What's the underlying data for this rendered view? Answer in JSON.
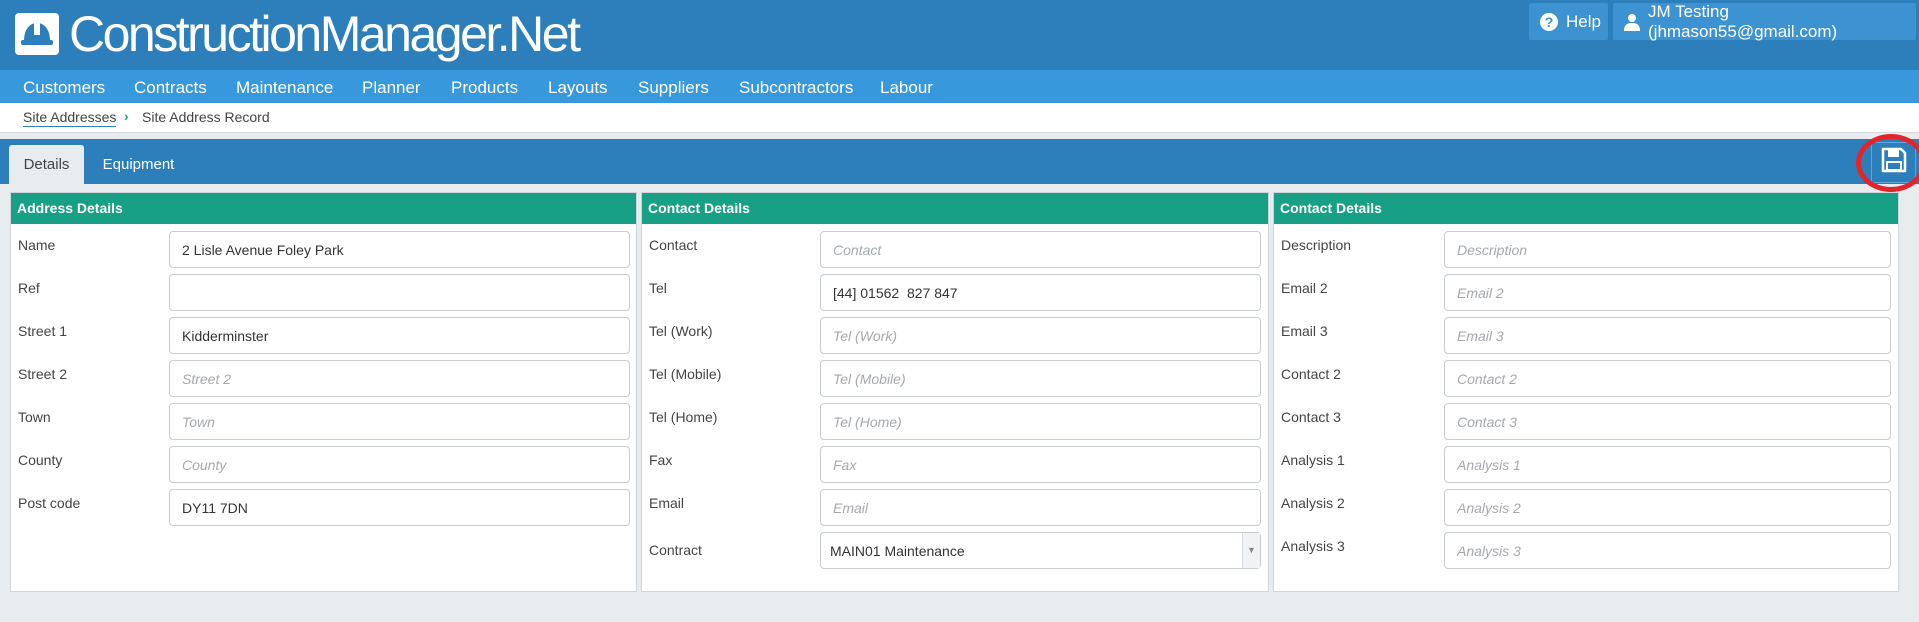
{
  "app": {
    "title": "ConstructionManager.Net",
    "logo_icon": "hard-hat-icon"
  },
  "header": {
    "help_label": "Help",
    "help_icon": "question-circle-icon",
    "user_label": "JM Testing (jhmason55@gmail.com)",
    "user_icon": "user-icon"
  },
  "nav": {
    "items": [
      {
        "label": "Customers"
      },
      {
        "label": "Contracts"
      },
      {
        "label": "Maintenance"
      },
      {
        "label": "Planner"
      },
      {
        "label": "Products"
      },
      {
        "label": "Layouts"
      },
      {
        "label": "Suppliers"
      },
      {
        "label": "Subcontractors"
      },
      {
        "label": "Labour"
      }
    ]
  },
  "breadcrumb": {
    "parent": "Site Addresses",
    "separator": "›",
    "current": "Site Address Record"
  },
  "tabs": {
    "items": [
      {
        "label": "Details",
        "active": true
      },
      {
        "label": "Equipment",
        "active": false
      }
    ],
    "save_icon": "floppy-disk-icon"
  },
  "colors": {
    "header_bg": "#2c7fbb",
    "nav_bg": "#3898dc",
    "panel_header_bg": "#17a086",
    "save_highlight": "#e1262b"
  },
  "panels": {
    "address": {
      "title": "Address Details",
      "fields": [
        {
          "label": "Name",
          "value": "2 Lisle Avenue Foley Park",
          "placeholder": ""
        },
        {
          "label": "Ref",
          "value": "",
          "placeholder": ""
        },
        {
          "label": "Street 1",
          "value": "Kidderminster",
          "placeholder": ""
        },
        {
          "label": "Street 2",
          "value": "",
          "placeholder": "Street 2"
        },
        {
          "label": "Town",
          "value": "",
          "placeholder": "Town"
        },
        {
          "label": "County",
          "value": "",
          "placeholder": "County"
        },
        {
          "label": "Post code",
          "value": "DY11 7DN",
          "placeholder": ""
        }
      ]
    },
    "contact": {
      "title": "Contact Details",
      "fields": [
        {
          "label": "Contact",
          "value": "",
          "placeholder": "Contact"
        },
        {
          "label": "Tel",
          "value": "[44] 01562  827 847",
          "placeholder": ""
        },
        {
          "label": "Tel (Work)",
          "value": "",
          "placeholder": "Tel (Work)"
        },
        {
          "label": "Tel (Mobile)",
          "value": "",
          "placeholder": "Tel (Mobile)"
        },
        {
          "label": "Tel (Home)",
          "value": "",
          "placeholder": "Tel (Home)"
        },
        {
          "label": "Fax",
          "value": "",
          "placeholder": "Fax"
        },
        {
          "label": "Email",
          "value": "",
          "placeholder": "Email"
        }
      ],
      "contract": {
        "label": "Contract",
        "selected": "MAIN01 Maintenance"
      }
    },
    "contact2": {
      "title": "Contact Details",
      "fields": [
        {
          "label": "Description",
          "value": "",
          "placeholder": "Description"
        },
        {
          "label": "Email 2",
          "value": "",
          "placeholder": "Email 2"
        },
        {
          "label": "Email 3",
          "value": "",
          "placeholder": "Email 3"
        },
        {
          "label": "Contact 2",
          "value": "",
          "placeholder": "Contact 2"
        },
        {
          "label": "Contact 3",
          "value": "",
          "placeholder": "Contact 3"
        },
        {
          "label": "Analysis 1",
          "value": "",
          "placeholder": "Analysis 1"
        },
        {
          "label": "Analysis 2",
          "value": "",
          "placeholder": "Analysis 2"
        },
        {
          "label": "Analysis 3",
          "value": "",
          "placeholder": "Analysis 3"
        }
      ]
    }
  }
}
